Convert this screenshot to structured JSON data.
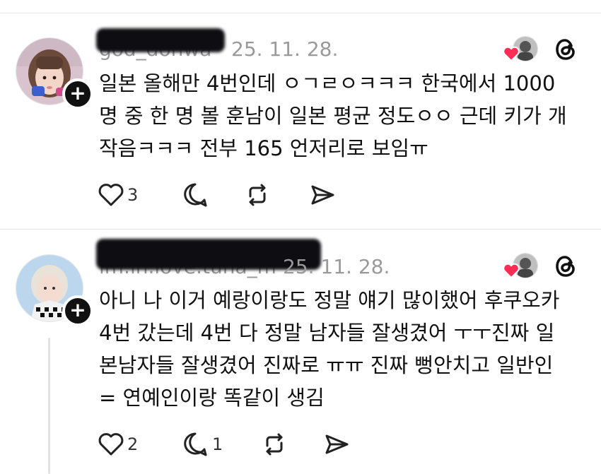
{
  "posts": [
    {
      "username": "god_dohwa",
      "date": "25. 11. 28.",
      "text": "일본 올해만 4번인데 ㅇㄱㄹㅇㅋㅋㅋ 한국에서 1000명 중 한 명 볼 훈남이 일본 평균 정도ㅇㅇ 근데 키가 개작음ㅋㅋㅋ 전부 165 언저리로 보임ㅠ",
      "lines": [
        "일본 올해만 4번인데 ㅇㄱㄹㅇㅋㅋㅋ 한국에서 1000",
        "명 중 한 명 볼 훈남이 일본 평균 정도ㅇㅇ 근데 키가 개",
        "작음ㅋㅋㅋ 전부 165 언저리로 보임ㅠ"
      ],
      "likes": "3",
      "replies": ""
    },
    {
      "username": "im.in.love.tuna_m",
      "date": "25. 11. 28.",
      "lines": [
        "아니 나 이거 예랑이랑도 정말 얘기 많이했어 후쿠오카",
        "4번 갔는데 4번 다 정말 남자들 잘생겼어 ㅜㅜ진짜 일",
        "본남자들 잘생겼어 진짜로 ㅠㅠ 진짜 뻥안치고 일반인",
        "= 연예인이랑 똑같이 생김"
      ],
      "likes": "2",
      "replies": "1"
    }
  ],
  "icons": {
    "like": "heart-outline-icon",
    "reply": "speech-bubble-icon",
    "repost": "repost-icon",
    "share": "paper-plane-icon",
    "badge": "red-heart-icon",
    "app": "threads-logo-icon"
  },
  "colors": {
    "heart_red": "#ff2d55",
    "meta_gray": "#9a9a9a",
    "text": "#111111"
  }
}
